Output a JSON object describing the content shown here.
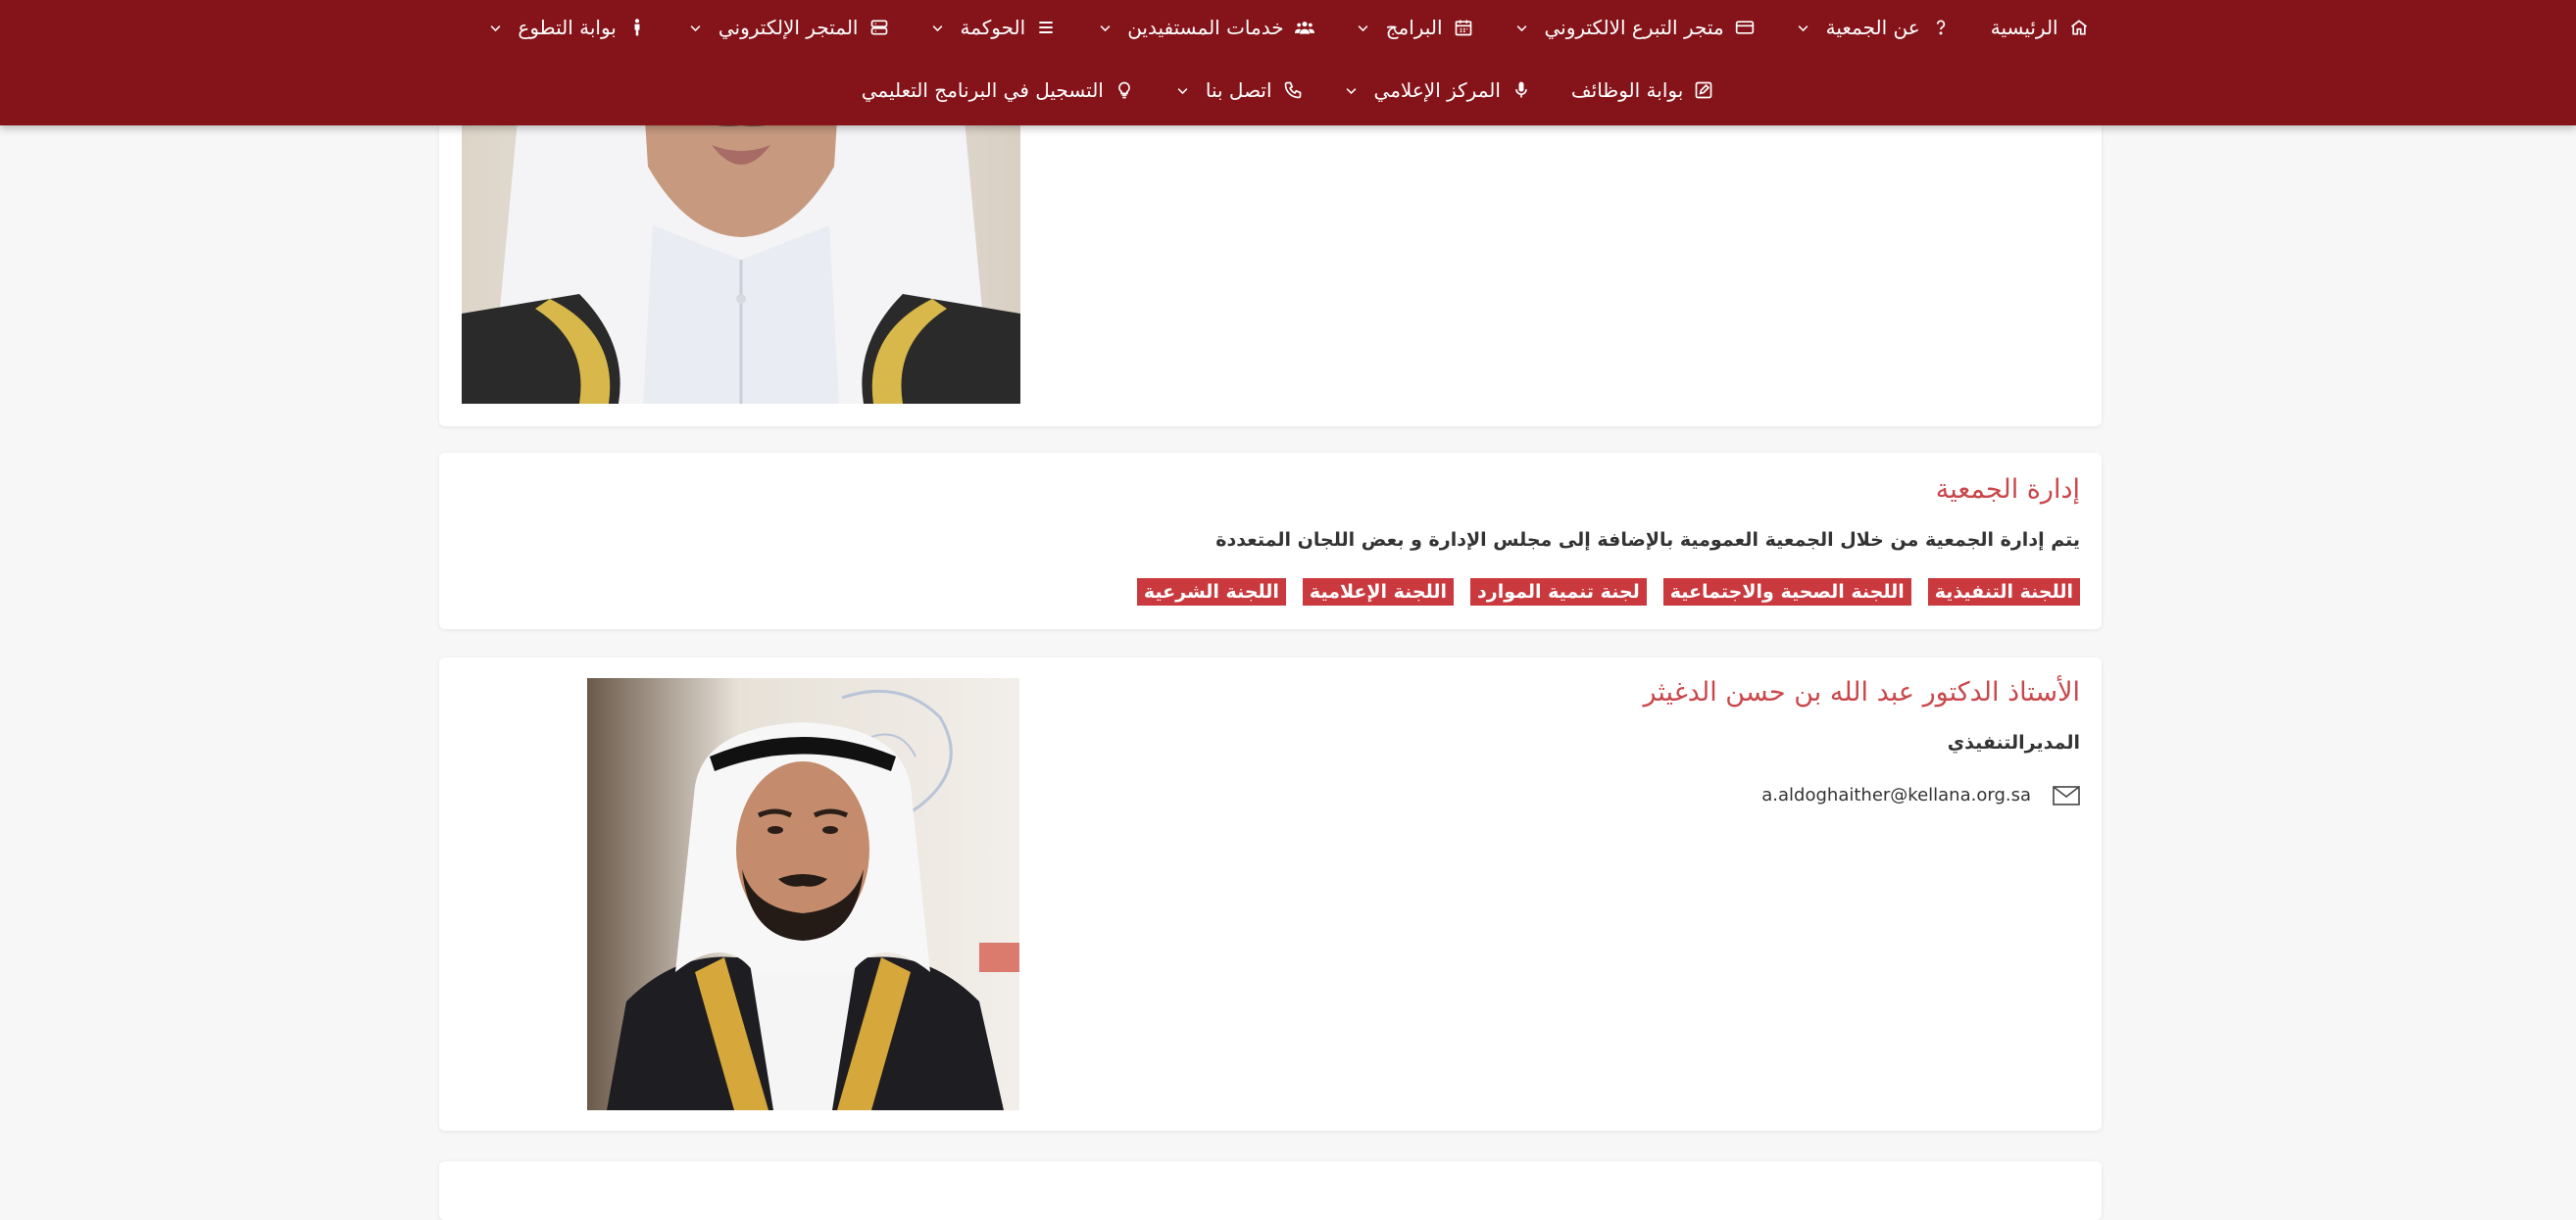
{
  "nav": {
    "row1": [
      {
        "label": "الرئيسية",
        "icon": "home-icon",
        "dropdown": false
      },
      {
        "label": "عن الجمعية",
        "icon": "question-icon",
        "dropdown": true
      },
      {
        "label": "متجر التبرع الالكتروني",
        "icon": "credit-card-icon",
        "dropdown": true
      },
      {
        "label": "البرامج",
        "icon": "calendar-icon",
        "dropdown": true
      },
      {
        "label": "خدمات المستفيدين",
        "icon": "users-icon",
        "dropdown": true
      },
      {
        "label": "الحوكمة",
        "icon": "list-icon",
        "dropdown": true
      },
      {
        "label": "المتجر الإلكتروني",
        "icon": "server-icon",
        "dropdown": true
      },
      {
        "label": "بوابة التطوع",
        "icon": "person-icon",
        "dropdown": true
      }
    ],
    "row2": [
      {
        "label": "بوابة الوظائف",
        "icon": "edit-icon",
        "dropdown": false
      },
      {
        "label": "المركز الإعلامي",
        "icon": "microphone-icon",
        "dropdown": true
      },
      {
        "label": "اتصل بنا",
        "icon": "phone-icon",
        "dropdown": true
      },
      {
        "label": "التسجيل في البرنامج التعليمي",
        "icon": "lightbulb-icon",
        "dropdown": false
      }
    ]
  },
  "management": {
    "title": "إدارة الجمعية",
    "description": "يتم إدارة الجمعية من خلال الجمعية العمومية بالإضافة إلى مجلس الإدارة و بعض اللجان المتعددة",
    "committees": [
      "اللجنة التنفيذية",
      "اللجنة الصحية والاجتماعية",
      "لجنة تنمية الموارد",
      "اللجنة الإعلامية",
      "اللجنة الشرعية"
    ]
  },
  "director": {
    "name": "الأستاذ الدكتور عبد الله بن حسن الدغيثر",
    "role": "المديرالتنفيذي",
    "email": "a.aldoghaither@kellana.org.sa"
  },
  "colors": {
    "nav_bg": "#85141a",
    "accent": "#c9474b",
    "tag_bg": "#c9393e"
  }
}
